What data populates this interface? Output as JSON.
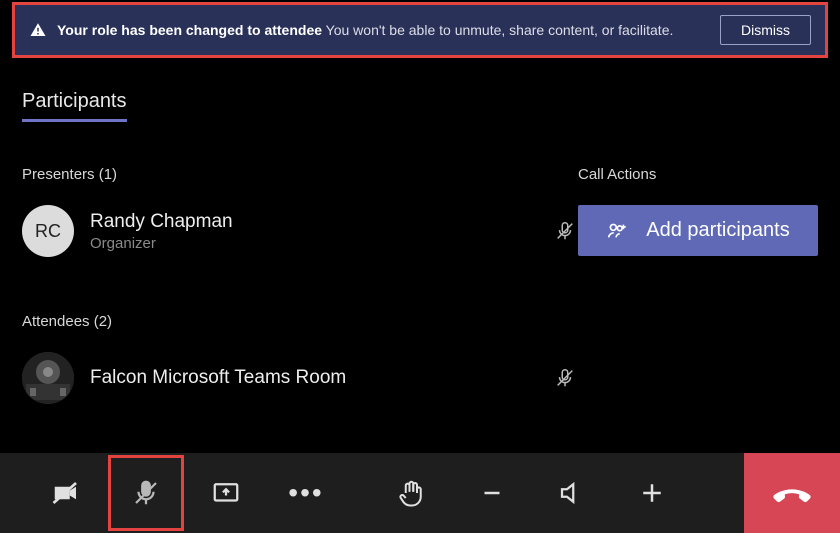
{
  "banner": {
    "title": "Your role has been changed to attendee",
    "detail": "You won't be able to unmute, share content, or facilitate.",
    "dismiss": "Dismiss"
  },
  "heading": "Participants",
  "presenters": {
    "label": "Presenters (1)",
    "items": [
      {
        "initials": "RC",
        "name": "Randy Chapman",
        "role": "Organizer",
        "muted": true
      }
    ]
  },
  "attendees": {
    "label": "Attendees (2)",
    "items": [
      {
        "name": "Falcon Microsoft Teams Room",
        "muted": true
      }
    ]
  },
  "callActions": {
    "label": "Call Actions",
    "add": "Add participants"
  }
}
